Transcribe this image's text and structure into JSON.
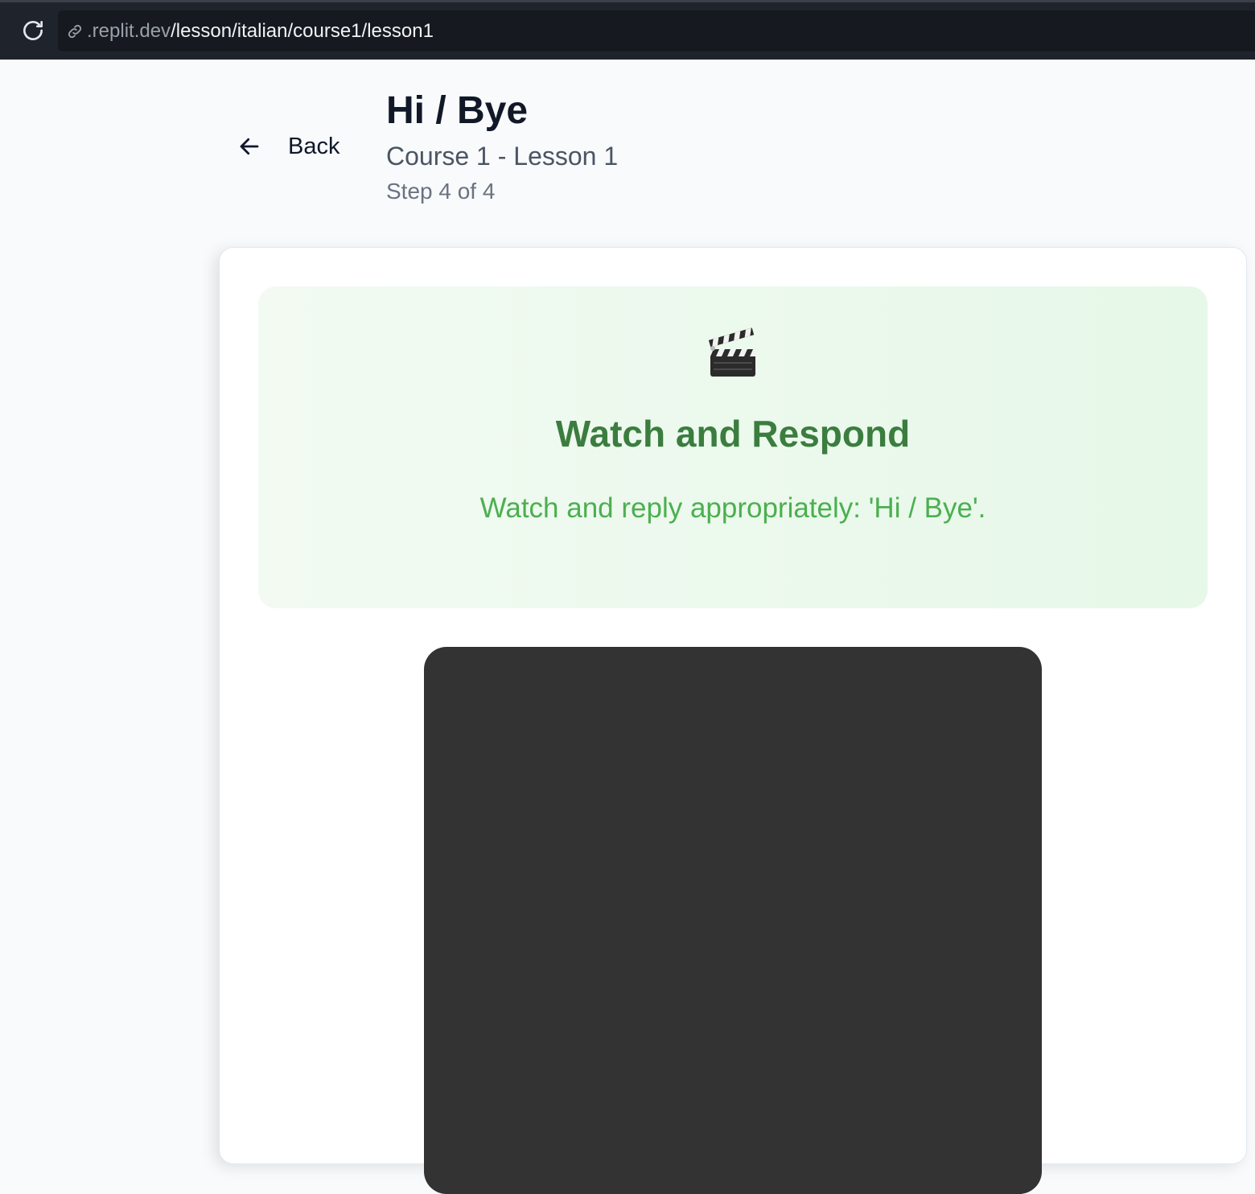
{
  "browser": {
    "url_host": ".replit.dev",
    "url_path": "/lesson/italian/course1/lesson1",
    "icons": [
      "reload-icon",
      "link-icon"
    ]
  },
  "header": {
    "back_label": "Back",
    "title": "Hi / Bye",
    "subtitle": "Course 1 - Lesson 1",
    "step": "Step 4 of 4",
    "icons": [
      "arrow-left-icon"
    ]
  },
  "instruction": {
    "icon": "clapper-board-icon",
    "title": "Watch and Respond",
    "text": "Watch and reply appropriately: 'Hi / Bye'."
  },
  "colors": {
    "browser_bar": "#1f232b",
    "page_background": "#f8fafc",
    "panel_title": "#3b7d3f",
    "panel_text": "#4caf50",
    "panel_background": "#e8f8ea",
    "video_background": "#333333"
  }
}
